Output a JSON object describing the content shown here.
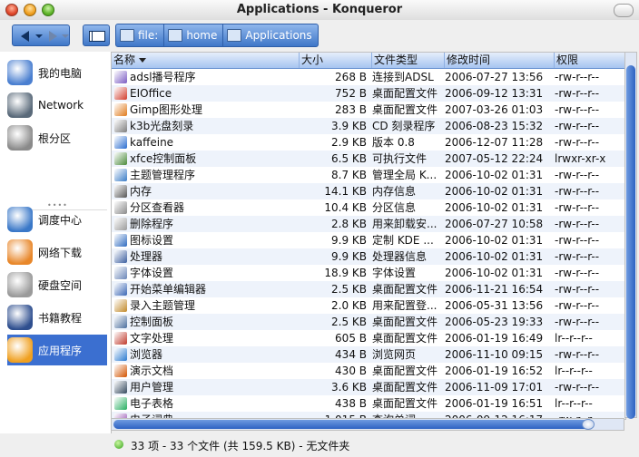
{
  "window": {
    "title": "Applications - Konqueror"
  },
  "breadcrumb": [
    "file:",
    "home",
    "Applications"
  ],
  "sidebar": {
    "top": [
      {
        "label": "我的电脑",
        "icon": "computer-icon"
      },
      {
        "label": "Network",
        "icon": "network-icon"
      },
      {
        "label": "根分区",
        "icon": "root-partition-icon"
      }
    ],
    "bottom": [
      {
        "label": "调度中心",
        "icon": "control-center-icon"
      },
      {
        "label": "网络下载",
        "icon": "download-icon"
      },
      {
        "label": "硬盘空间",
        "icon": "disk-space-icon"
      },
      {
        "label": "书籍教程",
        "icon": "books-icon"
      },
      {
        "label": "应用程序",
        "icon": "applications-icon",
        "active": true
      }
    ]
  },
  "columns": [
    "名称",
    "大小",
    "文件类型",
    "修改时间",
    "权限"
  ],
  "files": [
    {
      "name": "adsl播号程序",
      "size": "268 B",
      "type": "连接到ADSL",
      "date": "2006-07-27 13:56",
      "perm": "-rw-r--r--",
      "color": "#7b5cc4"
    },
    {
      "name": "EIOffice",
      "size": "752 B",
      "type": "桌面配置文件",
      "date": "2006-09-12 13:31",
      "perm": "-rw-r--r--",
      "color": "#d23b2b"
    },
    {
      "name": "Gimp图形处理",
      "size": "283 B",
      "type": "桌面配置文件",
      "date": "2007-03-26 01:03",
      "perm": "-rw-r--r--",
      "color": "#e07a1b"
    },
    {
      "name": "k3b光盘刻录",
      "size": "3.9 KB",
      "type": "CD 刻录程序",
      "date": "2006-08-23 15:32",
      "perm": "-rw-r--r--",
      "color": "#7d7d7d"
    },
    {
      "name": "kaffeine",
      "size": "2.9 KB",
      "type": "版本 0.8",
      "date": "2006-12-07 11:28",
      "perm": "-rw-r--r--",
      "color": "#2a6dd0"
    },
    {
      "name": "xfce控制面板",
      "size": "6.5 KB",
      "type": "可执行文件",
      "date": "2007-05-12 22:24",
      "perm": "lrwxr-xr-x",
      "color": "#4a8a3a"
    },
    {
      "name": "主题管理程序",
      "size": "8.7 KB",
      "type": "管理全局 K...",
      "date": "2006-10-02 01:31",
      "perm": "-rw-r--r--",
      "color": "#3a7cc7"
    },
    {
      "name": "内存",
      "size": "14.1 KB",
      "type": "内存信息",
      "date": "2006-10-02 01:31",
      "perm": "-rw-r--r--",
      "color": "#555555"
    },
    {
      "name": "分区查看器",
      "size": "10.4 KB",
      "type": "分区信息",
      "date": "2006-10-02 01:31",
      "perm": "-rw-r--r--",
      "color": "#8a8a8a"
    },
    {
      "name": "删除程序",
      "size": "2.8 KB",
      "type": "用来卸载安...",
      "date": "2006-07-27 10:58",
      "perm": "-rw-r--r--",
      "color": "#9a9a9a"
    },
    {
      "name": "图标设置",
      "size": "9.9 KB",
      "type": "定制 KDE ...",
      "date": "2006-10-02 01:31",
      "perm": "-rw-r--r--",
      "color": "#2e6ac0"
    },
    {
      "name": "处理器",
      "size": "9.9 KB",
      "type": "处理器信息",
      "date": "2006-10-02 01:31",
      "perm": "-rw-r--r--",
      "color": "#3c5fa0"
    },
    {
      "name": "字体设置",
      "size": "18.9 KB",
      "type": "字体设置",
      "date": "2006-10-02 01:31",
      "perm": "-rw-r--r--",
      "color": "#6a86b8"
    },
    {
      "name": "开始菜单编辑器",
      "size": "2.5 KB",
      "type": "桌面配置文件",
      "date": "2006-11-21 16:54",
      "perm": "-rw-r--r--",
      "color": "#3a66b5"
    },
    {
      "name": "录入主题管理",
      "size": "2.0 KB",
      "type": "用来配置登...",
      "date": "2006-05-31 13:56",
      "perm": "-rw-r--r--",
      "color": "#c28a2a"
    },
    {
      "name": "控制面板",
      "size": "2.5 KB",
      "type": "桌面配置文件",
      "date": "2006-05-23 19:33",
      "perm": "-rw-r--r--",
      "color": "#4b6e9e"
    },
    {
      "name": "文字处理",
      "size": "605 B",
      "type": "桌面配置文件",
      "date": "2006-01-19 16:49",
      "perm": "lr--r--r--",
      "color": "#c0392b"
    },
    {
      "name": "浏览器",
      "size": "434 B",
      "type": "浏览网页",
      "date": "2006-11-10 09:15",
      "perm": "-rw-r--r--",
      "color": "#2a7ad0"
    },
    {
      "name": "演示文档",
      "size": "430 B",
      "type": "桌面配置文件",
      "date": "2006-01-19 16:52",
      "perm": "lr--r--r--",
      "color": "#d35400"
    },
    {
      "name": "用户管理",
      "size": "3.6 KB",
      "type": "桌面配置文件",
      "date": "2006-11-09 17:01",
      "perm": "-rw-r--r--",
      "color": "#34495e"
    },
    {
      "name": "电子表格",
      "size": "438 B",
      "type": "桌面配置文件",
      "date": "2006-01-19 16:51",
      "perm": "lr--r--r--",
      "color": "#27ae60"
    },
    {
      "name": "电子词典",
      "size": "1,015 B",
      "type": "查询单词",
      "date": "2006-09-12 16:17",
      "perm": "-rw-r--r--",
      "color": "#8e44ad"
    }
  ],
  "status": {
    "text": "33 项 - 33 个文件 (共 159.5 KB) - 无文件夹"
  }
}
